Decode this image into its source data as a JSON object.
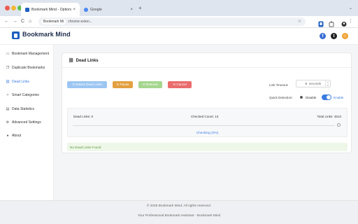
{
  "browser": {
    "tabs": [
      {
        "title": "Bookmark Mind - Options",
        "active": true
      },
      {
        "title": "Google",
        "active": false
      }
    ],
    "new_tab": "+",
    "caret": "⌄",
    "nav": {
      "back": "←",
      "forward": "→",
      "reload": "C",
      "home": "⌂"
    },
    "chip": "Bookmark Mi",
    "url": "chrome-exten...",
    "star": "☆",
    "kebab": "⋮"
  },
  "app": {
    "brand": "Bookmark Mind",
    "social": [
      {
        "name": "facebook-icon",
        "glyph": "f",
        "color": "#3b6fd4"
      },
      {
        "name": "twitter-icon",
        "glyph": "t",
        "color": "#222222"
      },
      {
        "name": "user-icon",
        "glyph": "☺",
        "color": "#f0a030"
      }
    ]
  },
  "sidebar": {
    "items": [
      {
        "label": "Bookmark Management",
        "icon": "folder-icon",
        "glyph": "▭"
      },
      {
        "label": "Duplicate Bookmarks",
        "icon": "duplicate-icon",
        "glyph": "❐"
      },
      {
        "label": "Dead Links",
        "icon": "link-icon",
        "glyph": "⛓",
        "active": true
      },
      {
        "label": "Smart Categories",
        "icon": "smart-icon",
        "glyph": "✧"
      },
      {
        "label": "Data Statistics",
        "icon": "chart-icon",
        "glyph": "▤"
      },
      {
        "label": "Advanced Settings",
        "icon": "gear-icon",
        "glyph": "⚙"
      },
      {
        "label": "About",
        "icon": "info-icon",
        "glyph": "●"
      }
    ]
  },
  "main": {
    "title": "Dead Links",
    "title_icon": "⛓",
    "buttons": {
      "detect": "⊙ Detect Dead Links",
      "pause": "⊙ Pause",
      "resume": "⊙ Resume",
      "cancel": "⊙ Cancel"
    },
    "timeout": {
      "label": "Link Timeout:",
      "value": "5",
      "unit": "seconds"
    },
    "quick_detection": {
      "label": "Quick Detection:",
      "disable": "Disable",
      "enable": "Enable",
      "enabled": true
    },
    "stats": {
      "dead": "Dead Links: 0",
      "checked": "Checked Count: 13",
      "total": "Total Links: 4513"
    },
    "progress_fraction": 0.0,
    "checking": "Checking (0%)",
    "result": "No Dead Links Found"
  },
  "footer": {
    "copyright": "© 2025 Bookmark Mind. All rights reserved.",
    "tagline": "Your Professional Bookmark Assistant - Bookmark Mind"
  }
}
